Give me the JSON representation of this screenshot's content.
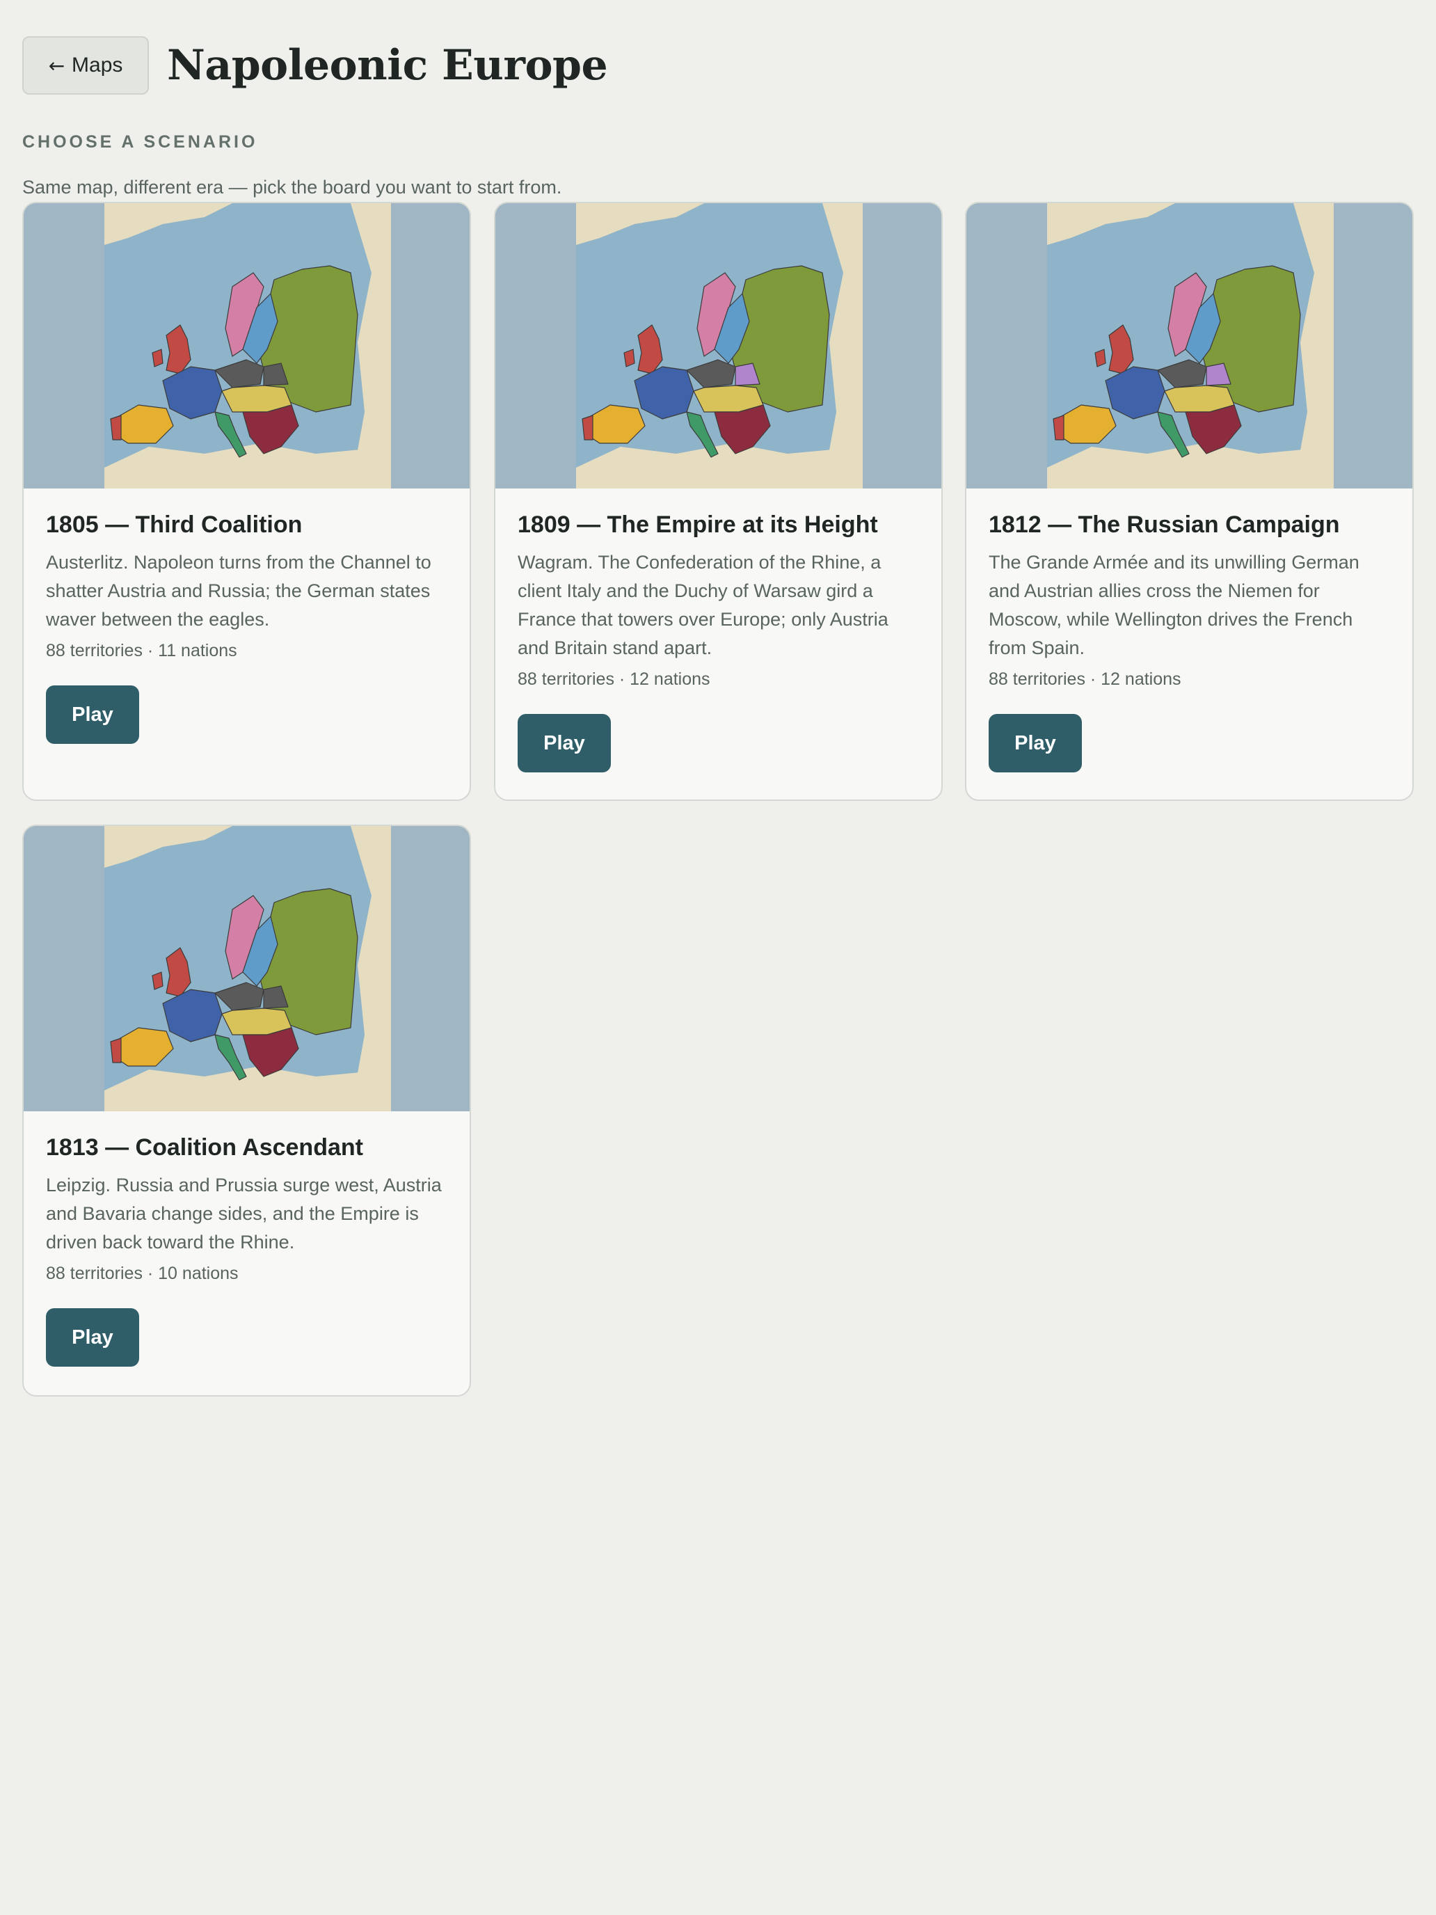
{
  "header": {
    "back_label": "Maps",
    "title": "Napoleonic Europe"
  },
  "section": {
    "label": "CHOOSE A SCENARIO",
    "subtitle": "Same map, different era — pick the board you want to start from."
  },
  "scenarios": [
    {
      "title": "1805 — Third Coalition",
      "description": "Austerlitz. Napoleon turns from the Channel to shatter Austria and Russia; the German states waver between the eagles.",
      "meta": "88 territories · 11 nations",
      "play_label": "Play"
    },
    {
      "title": "1809 — The Empire at its Height",
      "description": "Wagram. The Confederation of the Rhine, a client Italy and the Duchy of Warsaw gird a France that towers over Europe; only Austria and Britain stand apart.",
      "meta": "88 territories · 12 nations",
      "play_label": "Play"
    },
    {
      "title": "1812 — The Russian Campaign",
      "description": "The Grande Armée and its unwilling German and Austrian allies cross the Niemen for Moscow, while Wellington drives the French from Spain.",
      "meta": "88 territories · 12 nations",
      "play_label": "Play"
    },
    {
      "title": "1813 — Coalition Ascendant",
      "description": "Leipzig. Russia and Prussia surge west, Austria and Bavaria change sides, and the Empire is driven back toward the Rhine.",
      "meta": "88 territories · 10 nations",
      "play_label": "Play"
    }
  ],
  "colors": {
    "background": "#eff0ec",
    "play_button": "#2f5d68",
    "sea": "#8fb3c8",
    "land": "#e6dcbf",
    "russia": "#7f9a3a",
    "france": "#3f62a8",
    "britain": "#c24a44",
    "spain": "#e5b030",
    "ottoman": "#8e2c3f",
    "austria": "#d8c25a",
    "prussia": "#5a5a5a",
    "sweden": "#5f9cc9",
    "norway": "#d47fa6",
    "italy": "#3f9a68",
    "warsaw": "#b085cc"
  },
  "icons": {
    "back": "arrow-left-icon"
  }
}
